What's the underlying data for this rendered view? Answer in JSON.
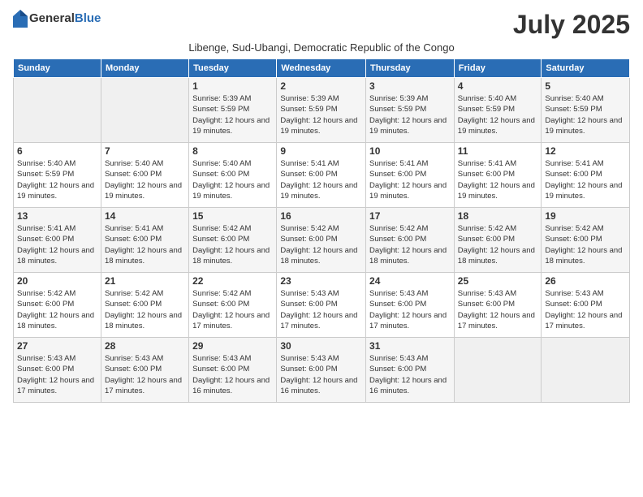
{
  "header": {
    "logo_general": "General",
    "logo_blue": "Blue",
    "month_title": "July 2025",
    "subtitle": "Libenge, Sud-Ubangi, Democratic Republic of the Congo"
  },
  "weekdays": [
    "Sunday",
    "Monday",
    "Tuesday",
    "Wednesday",
    "Thursday",
    "Friday",
    "Saturday"
  ],
  "weeks": [
    [
      {
        "day": "",
        "sunrise": "",
        "sunset": "",
        "daylight": ""
      },
      {
        "day": "",
        "sunrise": "",
        "sunset": "",
        "daylight": ""
      },
      {
        "day": "1",
        "sunrise": "Sunrise: 5:39 AM",
        "sunset": "Sunset: 5:59 PM",
        "daylight": "Daylight: 12 hours and 19 minutes."
      },
      {
        "day": "2",
        "sunrise": "Sunrise: 5:39 AM",
        "sunset": "Sunset: 5:59 PM",
        "daylight": "Daylight: 12 hours and 19 minutes."
      },
      {
        "day": "3",
        "sunrise": "Sunrise: 5:39 AM",
        "sunset": "Sunset: 5:59 PM",
        "daylight": "Daylight: 12 hours and 19 minutes."
      },
      {
        "day": "4",
        "sunrise": "Sunrise: 5:40 AM",
        "sunset": "Sunset: 5:59 PM",
        "daylight": "Daylight: 12 hours and 19 minutes."
      },
      {
        "day": "5",
        "sunrise": "Sunrise: 5:40 AM",
        "sunset": "Sunset: 5:59 PM",
        "daylight": "Daylight: 12 hours and 19 minutes."
      }
    ],
    [
      {
        "day": "6",
        "sunrise": "Sunrise: 5:40 AM",
        "sunset": "Sunset: 5:59 PM",
        "daylight": "Daylight: 12 hours and 19 minutes."
      },
      {
        "day": "7",
        "sunrise": "Sunrise: 5:40 AM",
        "sunset": "Sunset: 6:00 PM",
        "daylight": "Daylight: 12 hours and 19 minutes."
      },
      {
        "day": "8",
        "sunrise": "Sunrise: 5:40 AM",
        "sunset": "Sunset: 6:00 PM",
        "daylight": "Daylight: 12 hours and 19 minutes."
      },
      {
        "day": "9",
        "sunrise": "Sunrise: 5:41 AM",
        "sunset": "Sunset: 6:00 PM",
        "daylight": "Daylight: 12 hours and 19 minutes."
      },
      {
        "day": "10",
        "sunrise": "Sunrise: 5:41 AM",
        "sunset": "Sunset: 6:00 PM",
        "daylight": "Daylight: 12 hours and 19 minutes."
      },
      {
        "day": "11",
        "sunrise": "Sunrise: 5:41 AM",
        "sunset": "Sunset: 6:00 PM",
        "daylight": "Daylight: 12 hours and 19 minutes."
      },
      {
        "day": "12",
        "sunrise": "Sunrise: 5:41 AM",
        "sunset": "Sunset: 6:00 PM",
        "daylight": "Daylight: 12 hours and 19 minutes."
      }
    ],
    [
      {
        "day": "13",
        "sunrise": "Sunrise: 5:41 AM",
        "sunset": "Sunset: 6:00 PM",
        "daylight": "Daylight: 12 hours and 18 minutes."
      },
      {
        "day": "14",
        "sunrise": "Sunrise: 5:41 AM",
        "sunset": "Sunset: 6:00 PM",
        "daylight": "Daylight: 12 hours and 18 minutes."
      },
      {
        "day": "15",
        "sunrise": "Sunrise: 5:42 AM",
        "sunset": "Sunset: 6:00 PM",
        "daylight": "Daylight: 12 hours and 18 minutes."
      },
      {
        "day": "16",
        "sunrise": "Sunrise: 5:42 AM",
        "sunset": "Sunset: 6:00 PM",
        "daylight": "Daylight: 12 hours and 18 minutes."
      },
      {
        "day": "17",
        "sunrise": "Sunrise: 5:42 AM",
        "sunset": "Sunset: 6:00 PM",
        "daylight": "Daylight: 12 hours and 18 minutes."
      },
      {
        "day": "18",
        "sunrise": "Sunrise: 5:42 AM",
        "sunset": "Sunset: 6:00 PM",
        "daylight": "Daylight: 12 hours and 18 minutes."
      },
      {
        "day": "19",
        "sunrise": "Sunrise: 5:42 AM",
        "sunset": "Sunset: 6:00 PM",
        "daylight": "Daylight: 12 hours and 18 minutes."
      }
    ],
    [
      {
        "day": "20",
        "sunrise": "Sunrise: 5:42 AM",
        "sunset": "Sunset: 6:00 PM",
        "daylight": "Daylight: 12 hours and 18 minutes."
      },
      {
        "day": "21",
        "sunrise": "Sunrise: 5:42 AM",
        "sunset": "Sunset: 6:00 PM",
        "daylight": "Daylight: 12 hours and 18 minutes."
      },
      {
        "day": "22",
        "sunrise": "Sunrise: 5:42 AM",
        "sunset": "Sunset: 6:00 PM",
        "daylight": "Daylight: 12 hours and 17 minutes."
      },
      {
        "day": "23",
        "sunrise": "Sunrise: 5:43 AM",
        "sunset": "Sunset: 6:00 PM",
        "daylight": "Daylight: 12 hours and 17 minutes."
      },
      {
        "day": "24",
        "sunrise": "Sunrise: 5:43 AM",
        "sunset": "Sunset: 6:00 PM",
        "daylight": "Daylight: 12 hours and 17 minutes."
      },
      {
        "day": "25",
        "sunrise": "Sunrise: 5:43 AM",
        "sunset": "Sunset: 6:00 PM",
        "daylight": "Daylight: 12 hours and 17 minutes."
      },
      {
        "day": "26",
        "sunrise": "Sunrise: 5:43 AM",
        "sunset": "Sunset: 6:00 PM",
        "daylight": "Daylight: 12 hours and 17 minutes."
      }
    ],
    [
      {
        "day": "27",
        "sunrise": "Sunrise: 5:43 AM",
        "sunset": "Sunset: 6:00 PM",
        "daylight": "Daylight: 12 hours and 17 minutes."
      },
      {
        "day": "28",
        "sunrise": "Sunrise: 5:43 AM",
        "sunset": "Sunset: 6:00 PM",
        "daylight": "Daylight: 12 hours and 17 minutes."
      },
      {
        "day": "29",
        "sunrise": "Sunrise: 5:43 AM",
        "sunset": "Sunset: 6:00 PM",
        "daylight": "Daylight: 12 hours and 16 minutes."
      },
      {
        "day": "30",
        "sunrise": "Sunrise: 5:43 AM",
        "sunset": "Sunset: 6:00 PM",
        "daylight": "Daylight: 12 hours and 16 minutes."
      },
      {
        "day": "31",
        "sunrise": "Sunrise: 5:43 AM",
        "sunset": "Sunset: 6:00 PM",
        "daylight": "Daylight: 12 hours and 16 minutes."
      },
      {
        "day": "",
        "sunrise": "",
        "sunset": "",
        "daylight": ""
      },
      {
        "day": "",
        "sunrise": "",
        "sunset": "",
        "daylight": ""
      }
    ]
  ]
}
